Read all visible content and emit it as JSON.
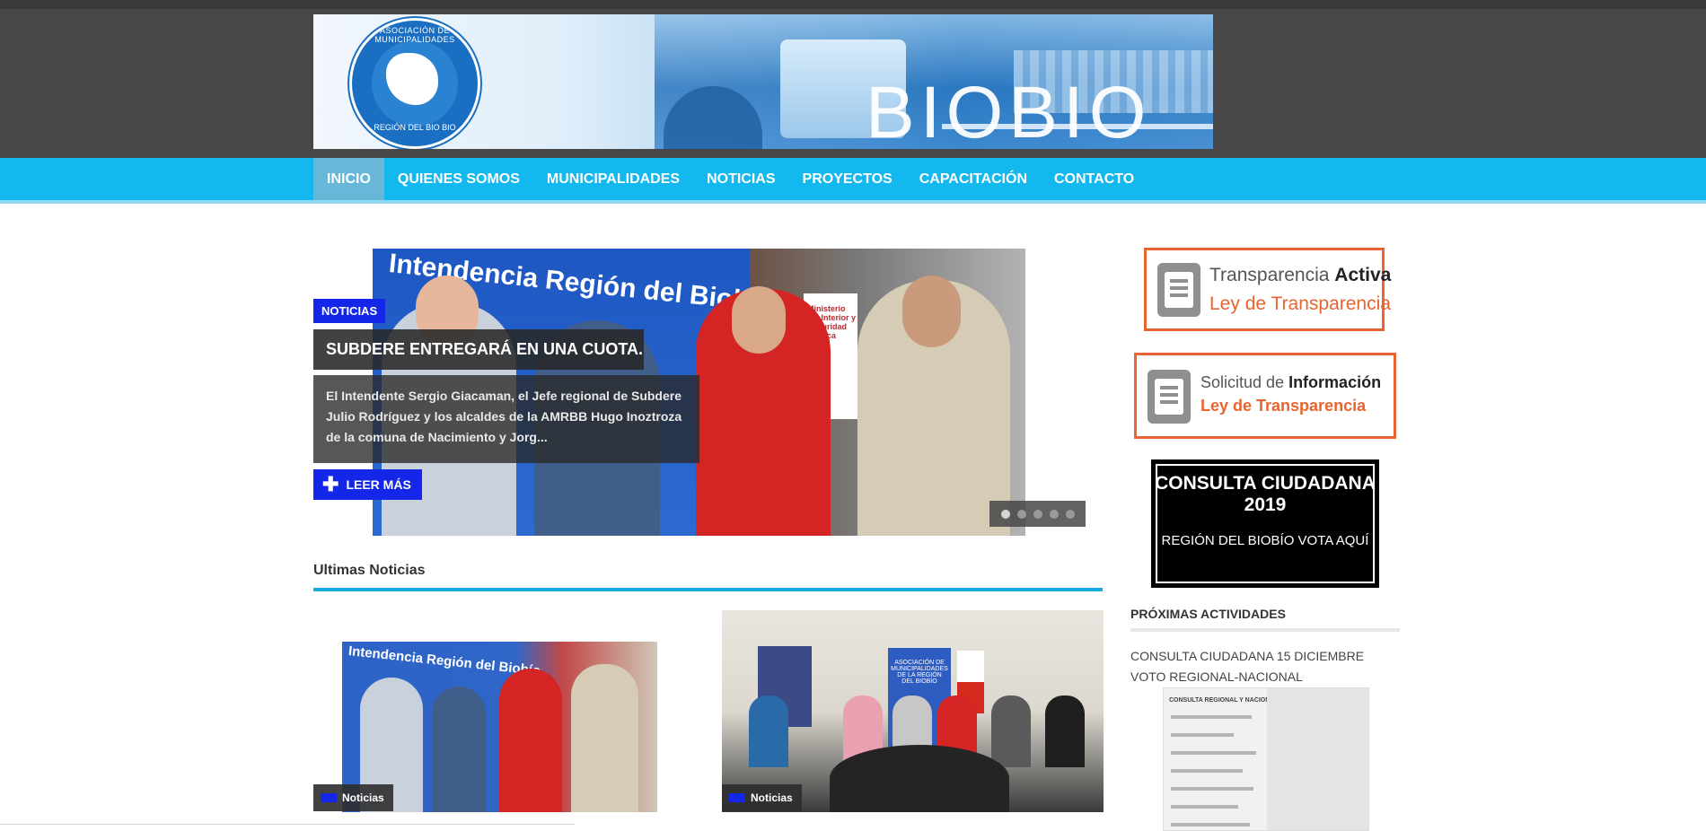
{
  "header": {
    "logo_text_top": "ASOCIACIÓN DE MUNICIPALIDADES",
    "logo_text_bottom": "REGIÓN DEL BIO BIO",
    "brand": "BIOBIO"
  },
  "nav": {
    "items": [
      "INICIO",
      "QUIENES SOMOS",
      "MUNICIPALIDADES",
      "NOTICIAS",
      "PROYECTOS",
      "CAPACITACIÓN",
      "CONTACTO"
    ],
    "active": "INICIO"
  },
  "slider": {
    "sign_text": "Intendencia Región del Biobío",
    "ministerio_text": "Ministerio del Interior y Seguridad Pública",
    "category": "NOTICIAS",
    "headline": "SUBDERE ENTREGARÁ EN UNA CUOTA...",
    "excerpt": "El Intendente Sergio Giacaman, el Jefe regional de Subdere Julio Rodríguez y los alcaldes de la AMRBB Hugo Inoztroza de la comuna de Nacimiento y Jorg...",
    "read_more": "LEER MÁS",
    "slide_count": 5,
    "active_slide": 1
  },
  "latest": {
    "title": "Ultimas Noticias",
    "cards": [
      {
        "tag": "Noticias",
        "sign_text": "Intendencia Región del Biobío"
      },
      {
        "tag": "Noticias",
        "banner_text": "ASOCIACIÓN DE MUNICIPALIDADES DE LA REGIÓN DEL BIOBÍO"
      }
    ]
  },
  "sidebar": {
    "transparencia": {
      "line1_a": "Transparencia ",
      "line1_b": "Activa",
      "line2": "Ley de Transparencia"
    },
    "solicitud": {
      "line1_a": "Solicitud de ",
      "line1_b": "Información",
      "line2": "Ley de Transparencia"
    },
    "consulta": {
      "title": "CONSULTA CIUDADANA 2019",
      "subtitle": "REGIÓN DEL BIOBÍO VOTA AQUÍ"
    },
    "activities": {
      "title": "PRÓXIMAS ACTIVIDADES",
      "item": "CONSULTA CIUDADANA 15 DICIEMBRE VOTO REGIONAL-NACIONAL",
      "img_title": "CONSULTA REGIONAL Y NACIONAL"
    }
  },
  "colors": {
    "header_bg": "#474747",
    "nav_bg": "#13b8ef",
    "accent_blue": "#1427e8",
    "transparency_orange": "#e9642f"
  },
  "icons": {
    "read_more": "plus-icon",
    "document": "document-list-icon"
  }
}
